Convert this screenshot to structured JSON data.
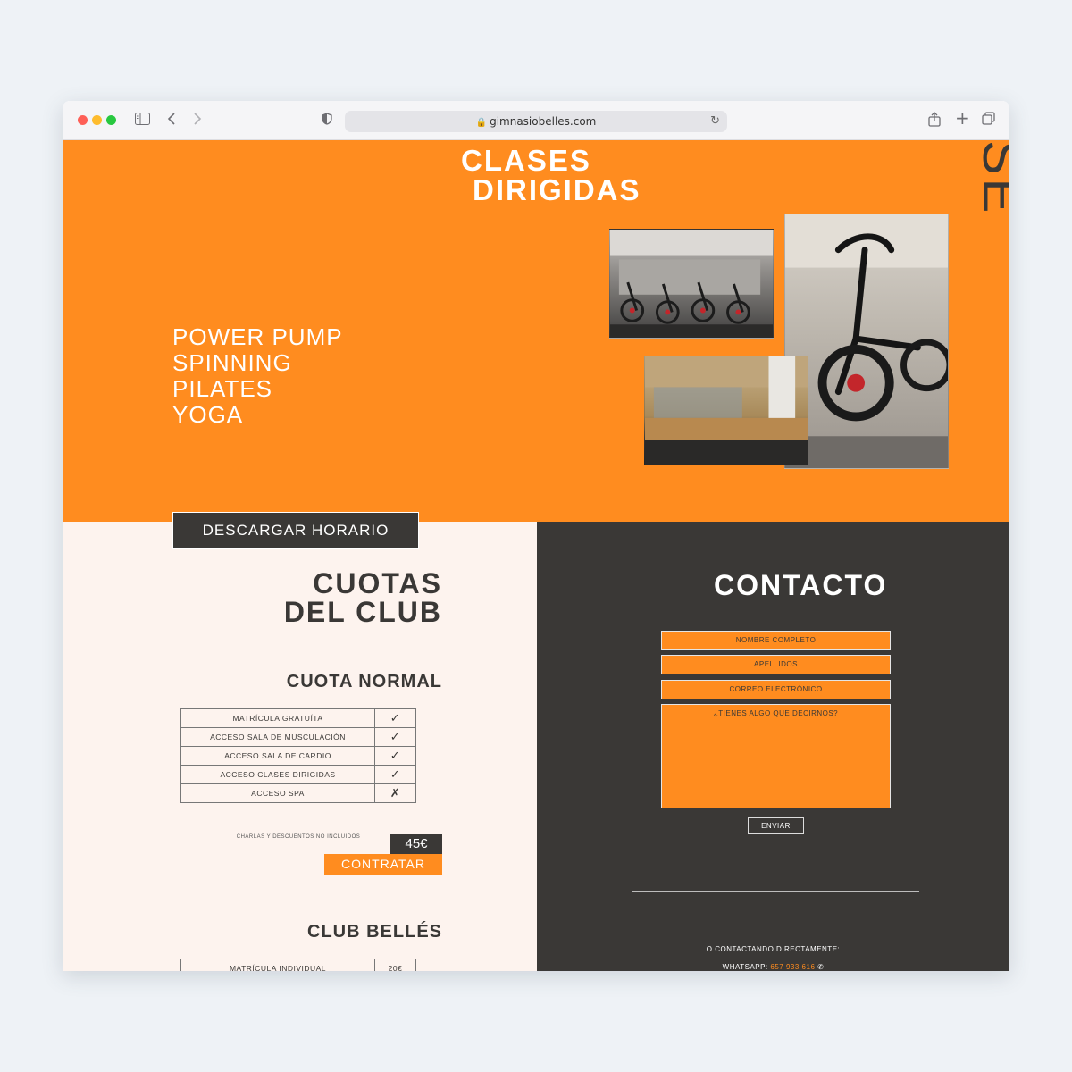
{
  "browser": {
    "url": "gimnasiobelles.com"
  },
  "hero": {
    "title_line1": "CLASES",
    "title_line2": "DIRIGIDAS",
    "side_word": "SE",
    "classes": [
      "POWER PUMP",
      "SPINNING",
      "PILATES",
      "YOGA"
    ]
  },
  "schedule_button": "DESCARGAR HORARIO",
  "fees": {
    "title_line1": "CUOTAS",
    "title_line2": "DEL CLUB",
    "normal": {
      "title": "CUOTA NORMAL",
      "rows": [
        {
          "label": "MATRÍCULA GRATUÍTA",
          "mark": "✓"
        },
        {
          "label": "ACCESO SALA DE MUSCULACIÓN",
          "mark": "✓"
        },
        {
          "label": "ACCESO SALA DE CARDIO",
          "mark": "✓"
        },
        {
          "label": "ACCESO CLASES DIRIGIDAS",
          "mark": "✓"
        },
        {
          "label": "ACCESO SPA",
          "mark": "✗"
        }
      ],
      "note": "CHARLAS Y DESCUENTOS NO INCLUIDOS",
      "price": "45€",
      "cta": "CONTRATAR"
    },
    "club": {
      "title": "CLUB BELLÉS",
      "rows": [
        {
          "label": "MATRÍCULA INDIVIDUAL",
          "mark": "20€"
        }
      ]
    }
  },
  "contact": {
    "title": "CONTACTO",
    "fields": [
      "NOMBRE COMPLETO",
      "APELLIDOS",
      "CORREO ELECTRÓNICO"
    ],
    "message_placeholder": "¿TIENES ALGO QUE DECIRNOS?",
    "send": "ENVIAR",
    "direct_label": "O CONTACTANDO DIRECTAMENTE:",
    "whatsapp_label": "WHATSAPP:",
    "whatsapp_number": "657 933 616"
  },
  "colors": {
    "orange": "#ff8c1f",
    "dark": "#3a3836",
    "cream": "#fdf3ee"
  }
}
